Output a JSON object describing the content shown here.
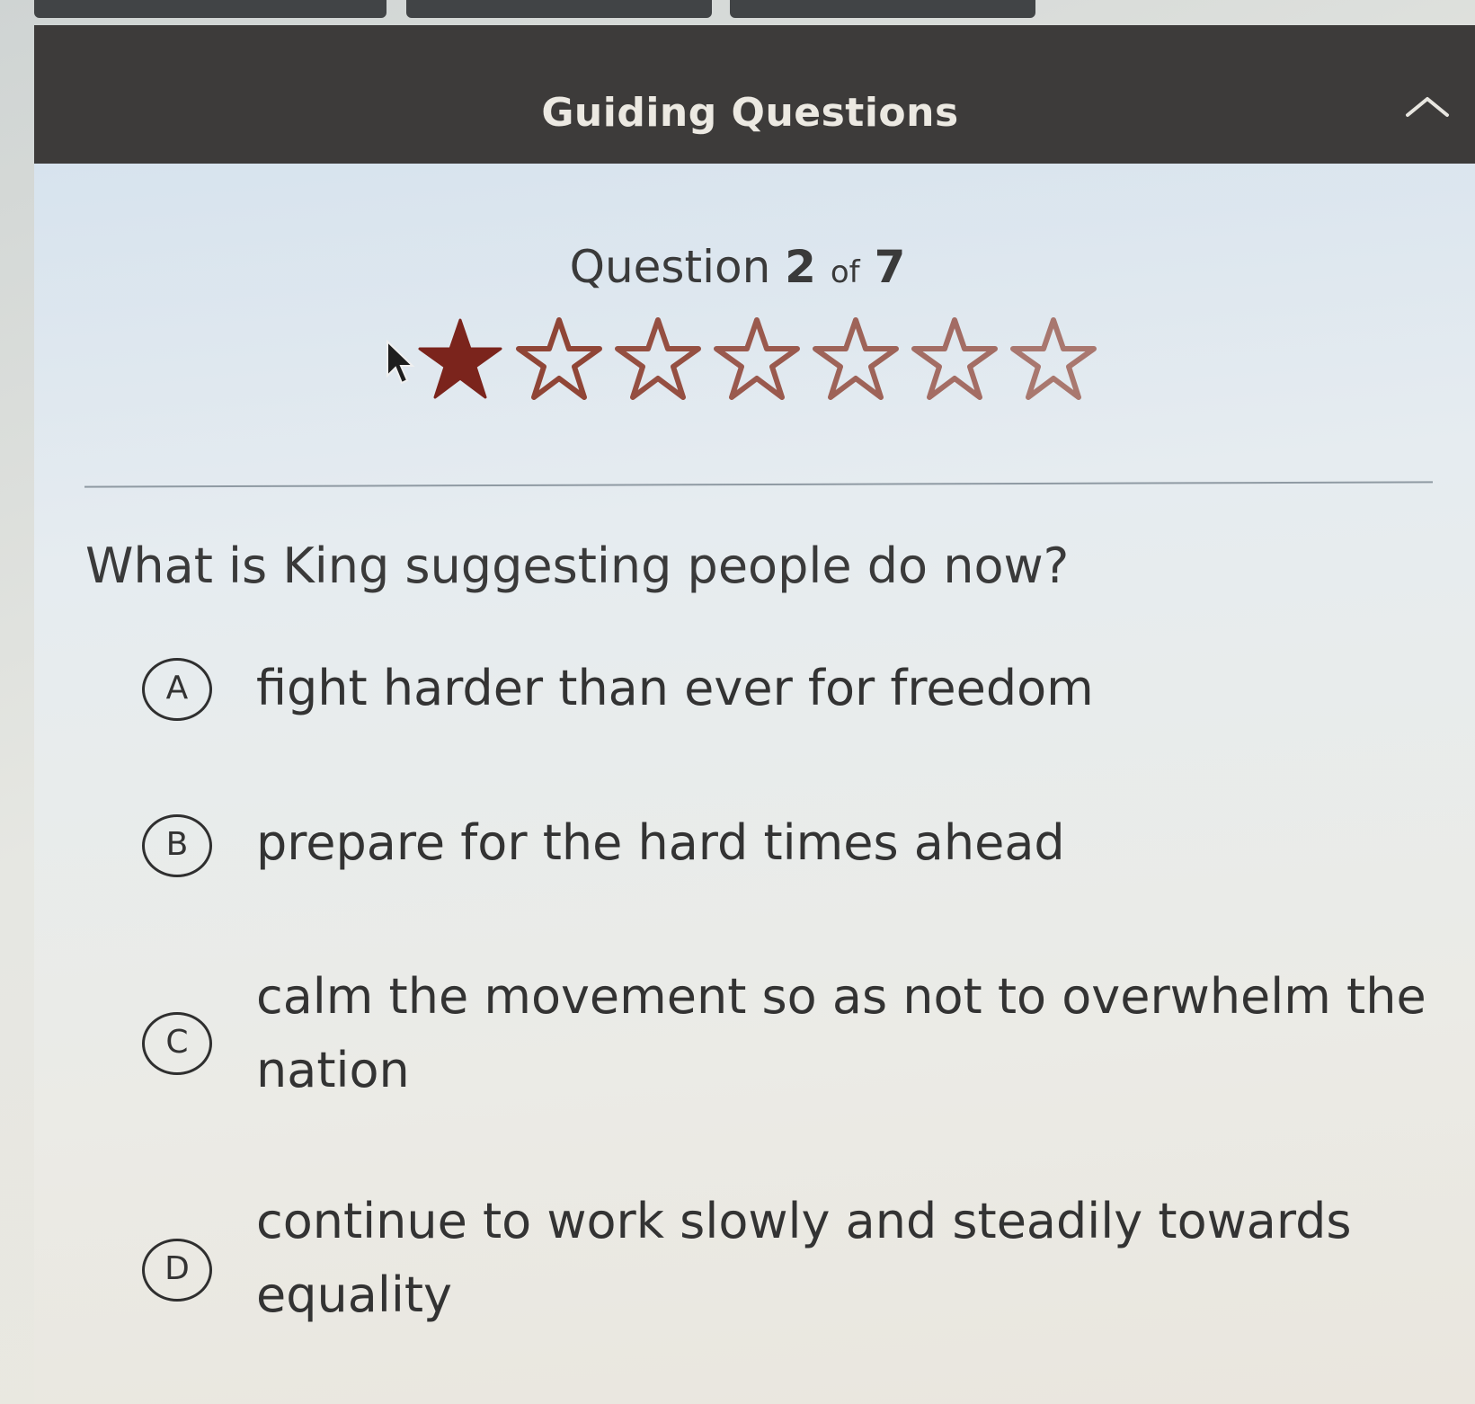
{
  "panel": {
    "title": "Guiding Questions",
    "collapse_icon": "chevron-up-icon"
  },
  "progress": {
    "prefix": "Question",
    "current": "2",
    "of_label": "of",
    "total": "7",
    "stars_filled": 1,
    "stars_total": 7,
    "filled_color": "#7b241c",
    "outline_color": "#8a3a2a"
  },
  "question": {
    "text": "What is King suggesting people do now?"
  },
  "choices": [
    {
      "letter": "A",
      "text": "fight harder than ever for freedom"
    },
    {
      "letter": "B",
      "text": "prepare for the hard times ahead"
    },
    {
      "letter": "C",
      "text": "calm the movement so as not to overwhelm the nation"
    },
    {
      "letter": "D",
      "text": "continue to work slowly and steadily towards equality"
    }
  ]
}
